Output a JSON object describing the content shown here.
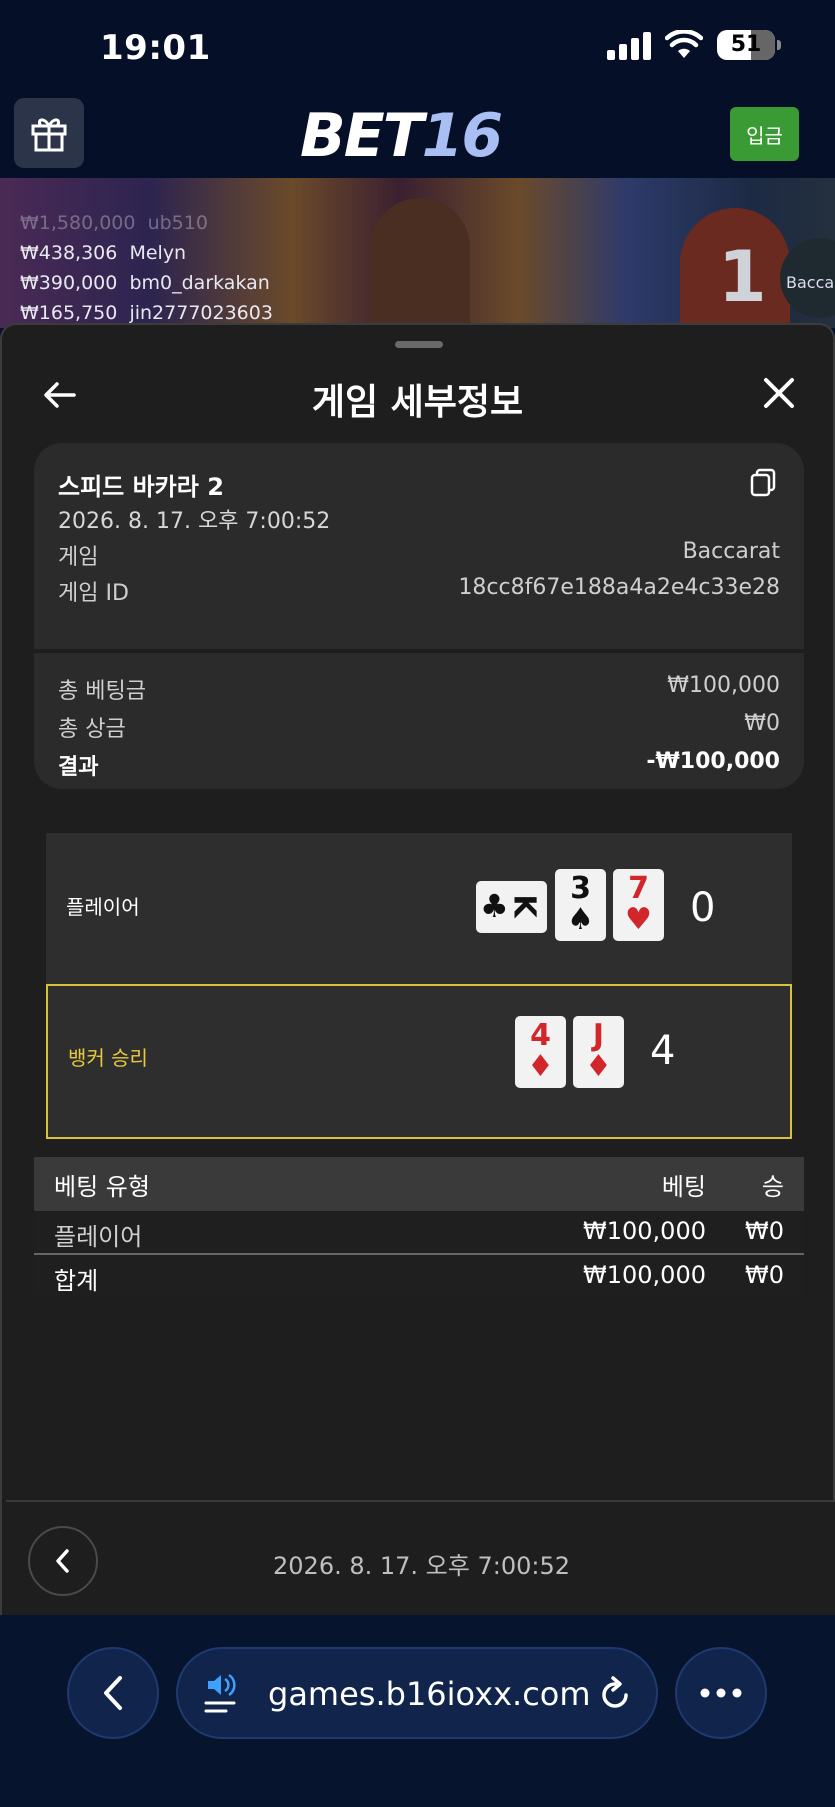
{
  "status_bar": {
    "time": "19:01",
    "battery": "51"
  },
  "topnav": {
    "logo_part1": "BET",
    "logo_part2": "16",
    "deposit_label": "입금"
  },
  "live_video": {
    "table_number": "1",
    "brand_badge": "Baccarat",
    "recent_winners": [
      {
        "amount": "₩1,580,000",
        "user": "ub510"
      },
      {
        "amount": "₩438,306",
        "user": "Melyn"
      },
      {
        "amount": "₩390,000",
        "user": "bm0_darkakan"
      },
      {
        "amount": "₩165,750",
        "user": "jin2777023603"
      }
    ]
  },
  "sheet": {
    "title": "게임 세부정보",
    "game_name": "스피드 바카라 2",
    "game_datetime": "2026. 8. 17. 오후 7:00:52",
    "game_label": "게임",
    "game_value": "Baccarat",
    "game_id_label": "게임 ID",
    "game_id_value": "18cc8f67e188a4a2e4c33e28",
    "total_bet_label": "총 베팅금",
    "total_bet_value": "₩100,000",
    "total_win_label": "총 상금",
    "total_win_value": "₩0",
    "result_label": "결과",
    "result_value": "-₩100,000"
  },
  "hand_result": {
    "player": {
      "label": "플레이어",
      "score": "0",
      "cards": [
        {
          "rank": "K",
          "suit": "♣",
          "color": "#111111"
        },
        {
          "rank": "3",
          "suit": "♠",
          "color": "#111111"
        },
        {
          "rank": "7",
          "suit": "♥",
          "color": "#d1262a"
        }
      ]
    },
    "banker": {
      "label": "뱅커 승리",
      "score": "4",
      "cards": [
        {
          "rank": "4",
          "suit": "♦",
          "color": "#d1262a"
        },
        {
          "rank": "J",
          "suit": "♦",
          "color": "#d1262a"
        }
      ]
    },
    "winner_highlight_color": "#d8c23a"
  },
  "bet_table": {
    "headers": {
      "type": "베팅 유형",
      "bet": "베팅",
      "win": "승"
    },
    "rows": [
      {
        "type": "플레이어",
        "bet": "₩100,000",
        "win": "₩0"
      }
    ],
    "total": {
      "type": "합계",
      "bet": "₩100,000",
      "win": "₩0"
    }
  },
  "sheet_footer": {
    "date": "2026. 8. 17. 오후 7:00:52"
  },
  "browser": {
    "url": "games.b16ioxx.com"
  },
  "colors": {
    "accent_green": "#3a9b35",
    "background": "#06112a",
    "sheet": "#1e1e1e",
    "winner_gold": "#e9c93d"
  }
}
